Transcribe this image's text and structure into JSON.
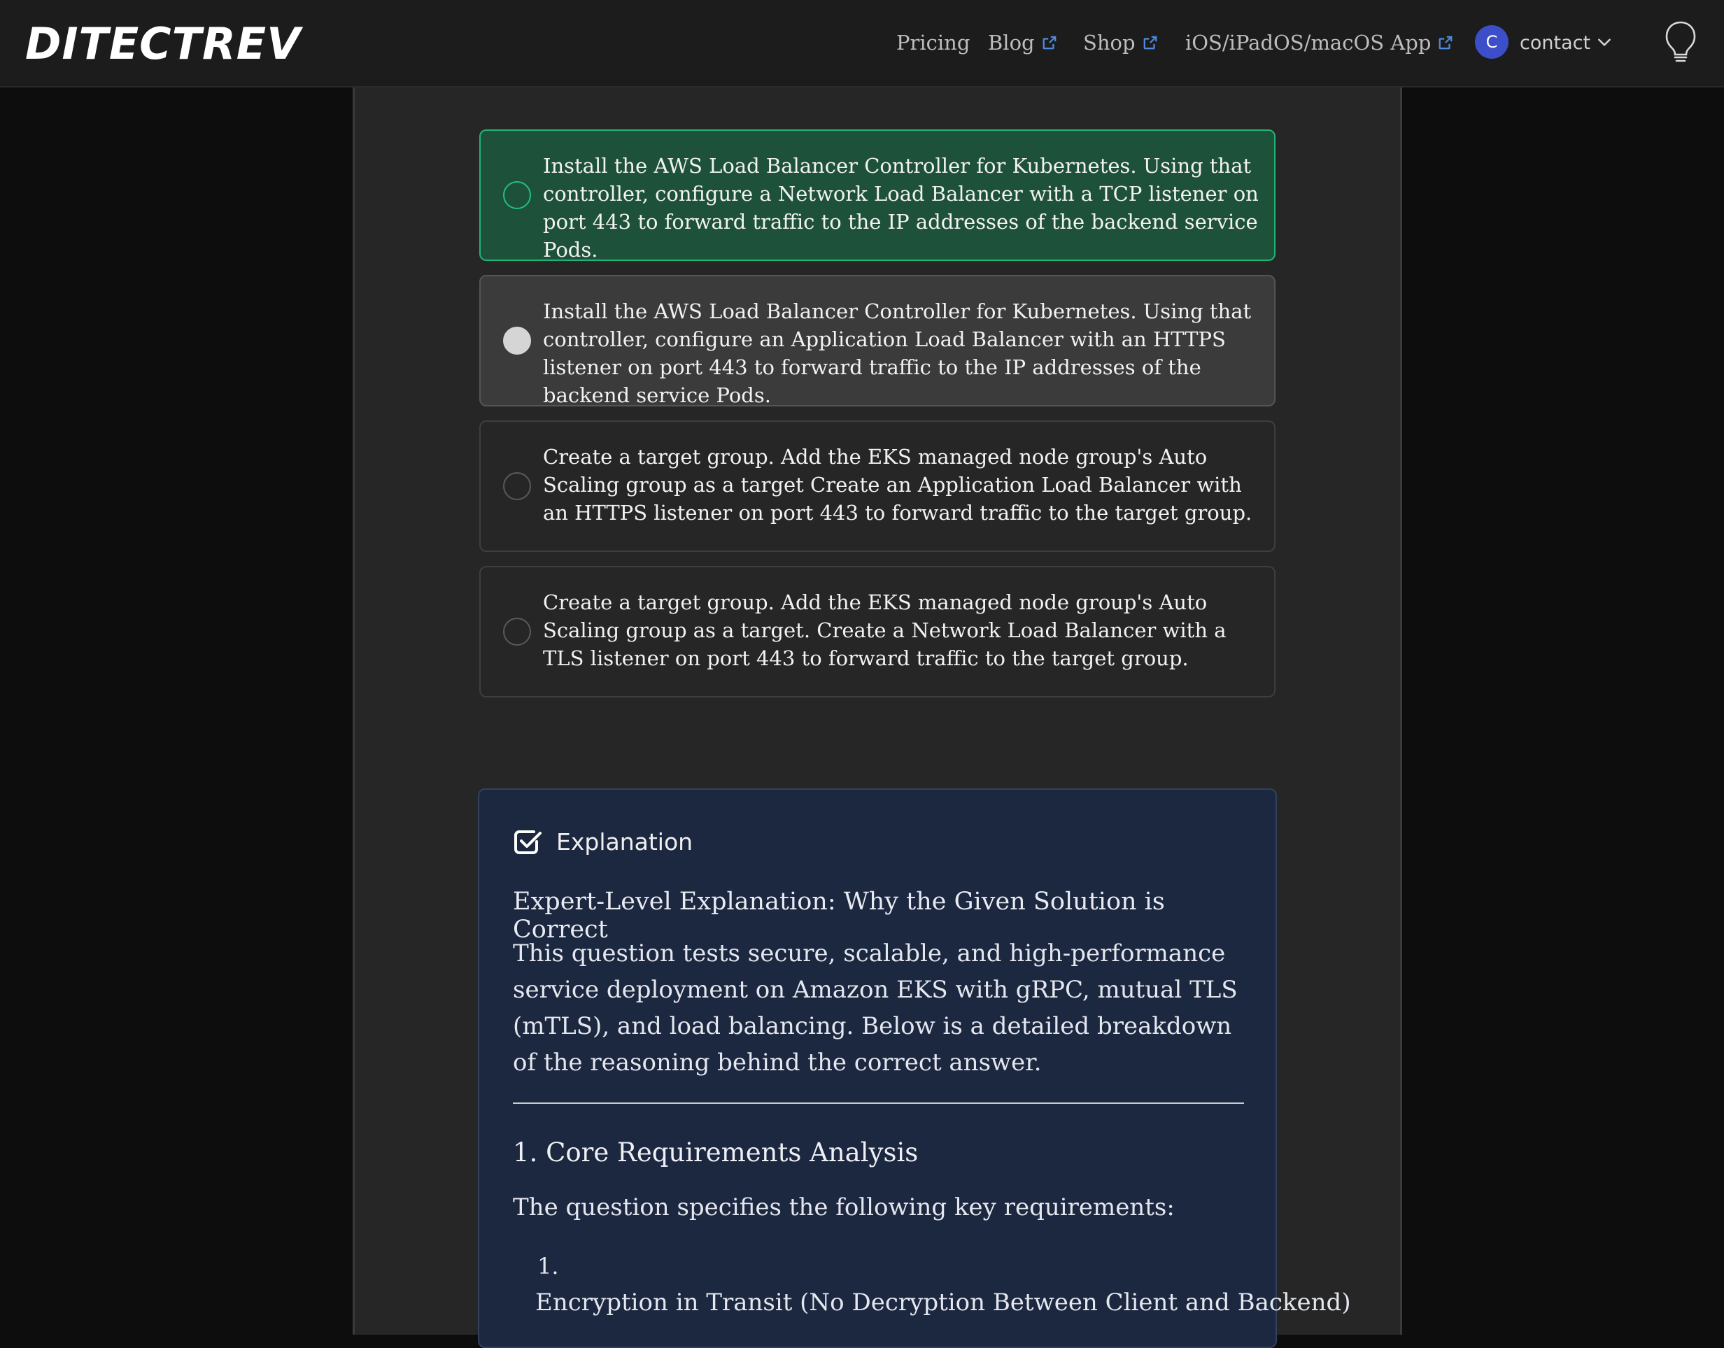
{
  "header": {
    "logo_text": "DITECTREV",
    "nav": [
      {
        "label": "Pricing",
        "external": false
      },
      {
        "label": "Blog",
        "external": true
      },
      {
        "label": "Shop",
        "external": true
      },
      {
        "label": "iOS/iPadOS/macOS App",
        "external": true
      }
    ],
    "avatar_initial": "C",
    "account_label": "contact"
  },
  "options": [
    {
      "text": "Install the AWS Load Balancer Controller for Kubernetes. Using that controller, configure a Network Load Balancer with a TCP listener on port 443 to forward traffic to the IP addresses of the backend service Pods.",
      "state": "correct"
    },
    {
      "text": "Install the AWS Load Balancer Controller for Kubernetes. Using that controller, configure an Application Load Balancer with an HTTPS listener on port 443 to forward traffic to the IP addresses of the backend service Pods.",
      "state": "selected"
    },
    {
      "text": "Create a target group. Add the EKS managed node group's Auto Scaling group as a target Create an Application Load Balancer with an HTTPS listener on port 443 to forward traffic to the target group.",
      "state": "default"
    },
    {
      "text": "Create a target group. Add the EKS managed node group's Auto Scaling group as a target. Create a Network Load Balancer with a TLS listener on port 443 to forward traffic to the target group.",
      "state": "default"
    }
  ],
  "explanation": {
    "title": "Explanation",
    "subtitle": "Expert-Level Explanation: Why the Given Solution is Correct",
    "intro": "This question tests secure, scalable, and high-performance service deployment on Amazon EKS with gRPC, mutual TLS (mTLS), and load balancing. Below is a detailed breakdown of the reasoning behind the correct answer.",
    "section_heading": "1. Core Requirements Analysis",
    "section_intro": "The question specifies the following key requirements:",
    "list_number": "1.",
    "list_item": "Encryption in Transit (No Decryption Between Client and Backend)"
  },
  "colors": {
    "correct_bg": "#1e5139",
    "correct_border": "#1fb577",
    "selected_bg": "#3b3b3b",
    "explanation_bg": "#1c2740",
    "avatar_bg": "#3c4fc8"
  }
}
